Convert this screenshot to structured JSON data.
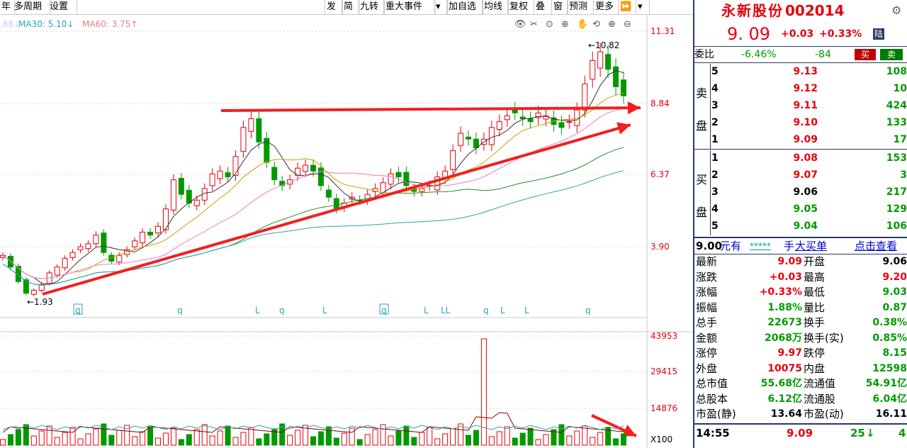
{
  "toolbar": {
    "left_items": [
      "年",
      "多周期",
      "设置"
    ],
    "right_items": [
      "发",
      "简",
      "九转",
      "重大事件",
      "▾",
      "加自选",
      "均线",
      "复权",
      "叠",
      "窗",
      "预测",
      "更多",
      "⏩",
      "▾"
    ]
  },
  "ma_legend": [
    {
      "text": ".68↓",
      "color": "#c8c8ff"
    },
    {
      "text": "MA30: 5.10↓",
      "color": "#2aa3b9"
    },
    {
      "text": "MA60: 3.75↑",
      "color": "#e87f7f"
    }
  ],
  "price_axis": [
    "11.31",
    "8.84",
    "6.37",
    "3.90"
  ],
  "volume_axis": [
    "43953",
    "29415",
    "14876",
    "X100"
  ],
  "annotations": {
    "high": "10.82",
    "low": "1.93"
  },
  "event_markers": [
    "q",
    "q",
    "L",
    "q",
    "L",
    "q",
    "L",
    "LL",
    "q",
    "L",
    "L",
    "q"
  ],
  "stock": {
    "name": "永新股份",
    "code": "002014",
    "price": "9. 09",
    "change": "+0.03",
    "change_pct": "+0.33%",
    "tag": "陆"
  },
  "weibi": {
    "label": "委比",
    "pct": "-6.46%",
    "diff": "-84",
    "buy_label": "买",
    "sell_label": "卖"
  },
  "sell_book": {
    "label": "卖盘",
    "rows": [
      {
        "level": "5",
        "price": "9.13",
        "vol": "108"
      },
      {
        "level": "4",
        "price": "9.12",
        "vol": "10"
      },
      {
        "level": "3",
        "price": "9.11",
        "vol": "424"
      },
      {
        "level": "2",
        "price": "9.10",
        "vol": "133"
      },
      {
        "level": "1",
        "price": "9.09",
        "vol": "17"
      }
    ]
  },
  "buy_book": {
    "label": "买盘",
    "rows": [
      {
        "level": "1",
        "price": "9.08",
        "vol": "153"
      },
      {
        "level": "2",
        "price": "9.07",
        "vol": "3"
      },
      {
        "level": "3",
        "price": "9.06",
        "vol": "217"
      },
      {
        "level": "4",
        "price": "9.05",
        "vol": "129"
      },
      {
        "level": "5",
        "price": "9.04",
        "vol": "106"
      }
    ]
  },
  "big_order": {
    "price": "9.00",
    "yuan": "元有",
    "stars": "*****",
    "hand": "手",
    "big": "大买单",
    "link": "点击查看"
  },
  "stats": [
    {
      "l1": "最新",
      "v1": "9.09",
      "c1": "red",
      "l2": "开盘",
      "v2": "9.06",
      "c2": "blk"
    },
    {
      "l1": "涨跌",
      "v1": "+0.03",
      "c1": "red",
      "l2": "最高",
      "v2": "9.20",
      "c2": "red"
    },
    {
      "l1": "涨幅",
      "v1": "+0.33%",
      "c1": "red",
      "l2": "最低",
      "v2": "9.03",
      "c2": "grn"
    },
    {
      "l1": "振幅",
      "v1": "1.88%",
      "c1": "grn",
      "l2": "量比",
      "v2": "0.87",
      "c2": "grn"
    },
    {
      "l1": "总手",
      "v1": "22673",
      "c1": "grn",
      "l2": "换手",
      "v2": "0.38%",
      "c2": "grn"
    },
    {
      "l1": "金额",
      "v1": "2068万",
      "c1": "grn",
      "l2": "换手(实)",
      "v2": "0.85%",
      "c2": "grn"
    },
    {
      "l1": "涨停",
      "v1": "9.97",
      "c1": "red",
      "l2": "跌停",
      "v2": "8.15",
      "c2": "grn"
    },
    {
      "l1": "外盘",
      "v1": "10075",
      "c1": "red",
      "l2": "内盘",
      "v2": "12598",
      "c2": "grn"
    },
    {
      "l1": "总市值",
      "v1": "55.68亿",
      "c1": "grn",
      "l2": "流通值",
      "v2": "54.91亿",
      "c2": "grn"
    },
    {
      "l1": "总股本",
      "v1": "6.12亿",
      "c1": "grn",
      "l2": "流通股",
      "v2": "6.04亿",
      "c2": "grn"
    },
    {
      "l1": "市盈(静)",
      "v1": "13.64",
      "c1": "blk",
      "l2": "市盈(动)",
      "v2": "16.11",
      "c2": "blk"
    }
  ],
  "tick": {
    "time": "14:55",
    "price": "9.09",
    "vol": "25",
    "dir": "↓",
    "num": "4"
  },
  "colors": {
    "up": "#e8000b",
    "down": "#009a00",
    "navy": "#2b3a66",
    "grid": "#d0d0d0"
  }
}
